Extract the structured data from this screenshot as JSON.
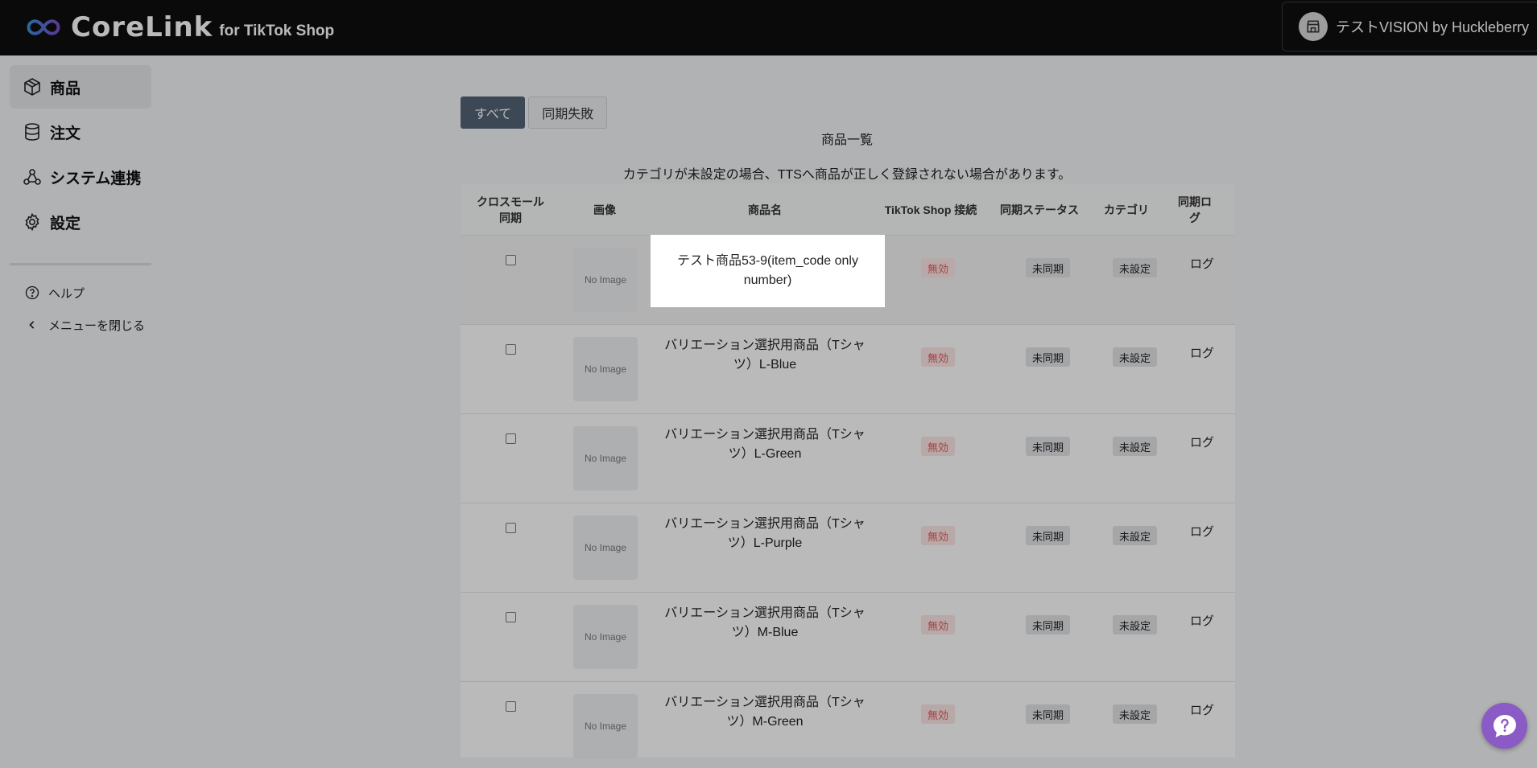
{
  "header": {
    "logo_text": "CoreLink",
    "logo_sub": "for TikTok Shop",
    "shop_name": "テストVISION by Huckleberry"
  },
  "sidebar": {
    "items": [
      {
        "label": "商品",
        "icon": "package-icon",
        "active": true
      },
      {
        "label": "注文",
        "icon": "database-icon",
        "active": false
      },
      {
        "label": "システム連携",
        "icon": "share-nodes-icon",
        "active": false
      },
      {
        "label": "設定",
        "icon": "gear-icon",
        "active": false
      }
    ],
    "sub_items": [
      {
        "label": "ヘルプ",
        "icon": "question-circle-icon"
      },
      {
        "label": "メニューを閉じる",
        "icon": "chevron-left-icon"
      }
    ]
  },
  "tabs": [
    {
      "label": "すべて",
      "active": true
    },
    {
      "label": "同期失敗",
      "active": false
    }
  ],
  "table_title": "商品一覧",
  "notice": "カテゴリが未設定の場合、TTSへ商品が正しく登録されない場合があります。",
  "table": {
    "headers": [
      "クロスモール\n同期",
      "画像",
      "商品名",
      "TikTok Shop 接続",
      "同期ステータス",
      "カテゴリ",
      "同期ロ\nグ"
    ],
    "rows": [
      {
        "name": "",
        "image": "No Image",
        "connection": "無効",
        "sync_status": "未同期",
        "category": "未設定",
        "log": "ログ"
      },
      {
        "name": "バリエーション選択用商品（Tシャツ）L-Blue",
        "image": "No Image",
        "connection": "無効",
        "sync_status": "未同期",
        "category": "未設定",
        "log": "ログ"
      },
      {
        "name": "バリエーション選択用商品（Tシャツ）L-Green",
        "image": "No Image",
        "connection": "無効",
        "sync_status": "未同期",
        "category": "未設定",
        "log": "ログ"
      },
      {
        "name": "バリエーション選択用商品（Tシャツ）L-Purple",
        "image": "No Image",
        "connection": "無効",
        "sync_status": "未同期",
        "category": "未設定",
        "log": "ログ"
      },
      {
        "name": "バリエーション選択用商品（Tシャツ）M-Blue",
        "image": "No Image",
        "connection": "無効",
        "sync_status": "未同期",
        "category": "未設定",
        "log": "ログ"
      },
      {
        "name": "バリエーション選択用商品（Tシャツ）M-Green",
        "image": "No Image",
        "connection": "無効",
        "sync_status": "未同期",
        "category": "未設定",
        "log": "ログ"
      }
    ]
  },
  "tooltip": {
    "text": "テスト商品53-9(item_code only number)"
  },
  "colors": {
    "header_bg": "#0f0f0f",
    "tab_active": "#536377",
    "invalid_badge_bg": "#fde7e7",
    "invalid_badge_text": "#e15b5b",
    "help_fab": "#8a5ac5"
  }
}
